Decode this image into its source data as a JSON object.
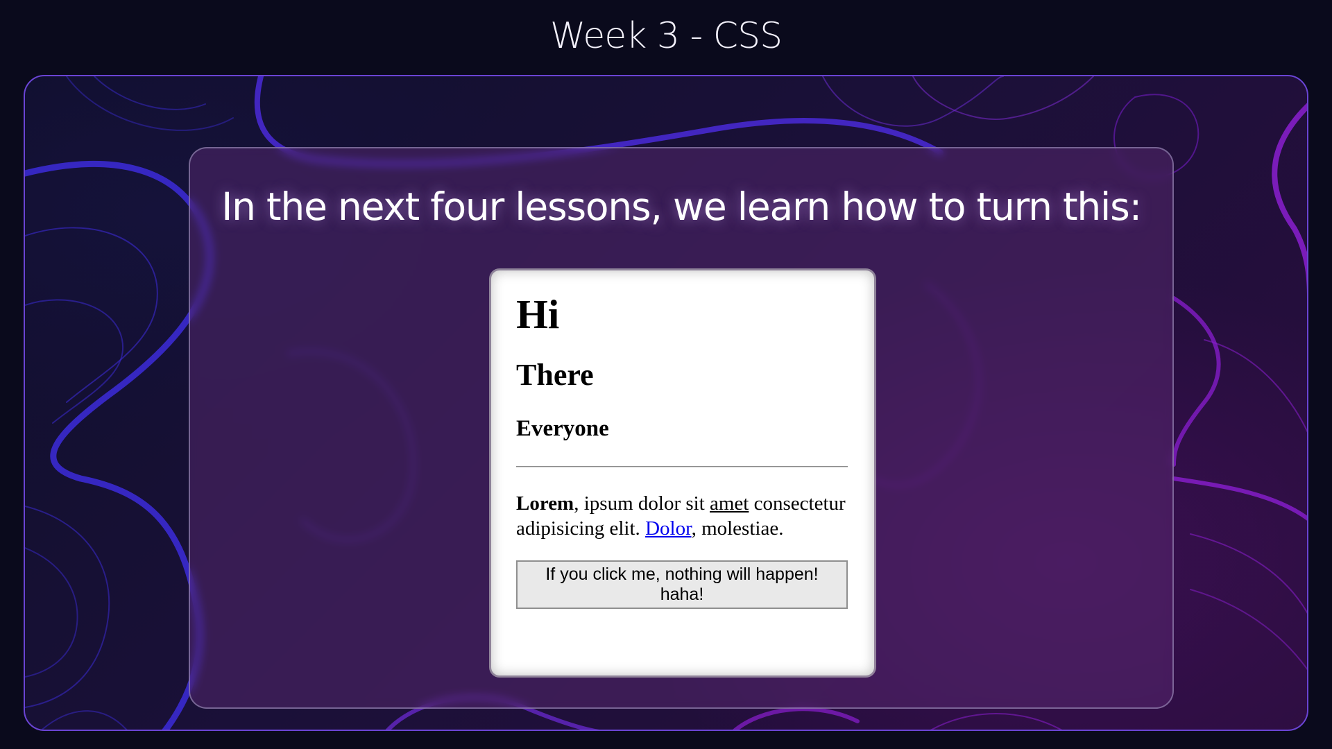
{
  "slide": {
    "title": "Week 3 - CSS"
  },
  "panel": {
    "headline": "In the next four lessons, we learn how to turn this:"
  },
  "demo_card": {
    "h1": "Hi",
    "h2": "There",
    "h3": "Everyone",
    "paragraph": {
      "bold": "Lorem",
      "text1": ", ipsum dolor sit ",
      "underlined": "amet",
      "text2": " consectetur adipisicing elit. ",
      "link": "Dolor",
      "text3": ", molestiae."
    },
    "button_label": "If you click me, nothing will happen! haha!"
  },
  "colors": {
    "page_background": "#0a0a1c",
    "frame_border": "#6a44d4",
    "contour_blue": "#3a2ad0",
    "contour_purple": "#8a1ed0",
    "link": "#0000ee"
  }
}
